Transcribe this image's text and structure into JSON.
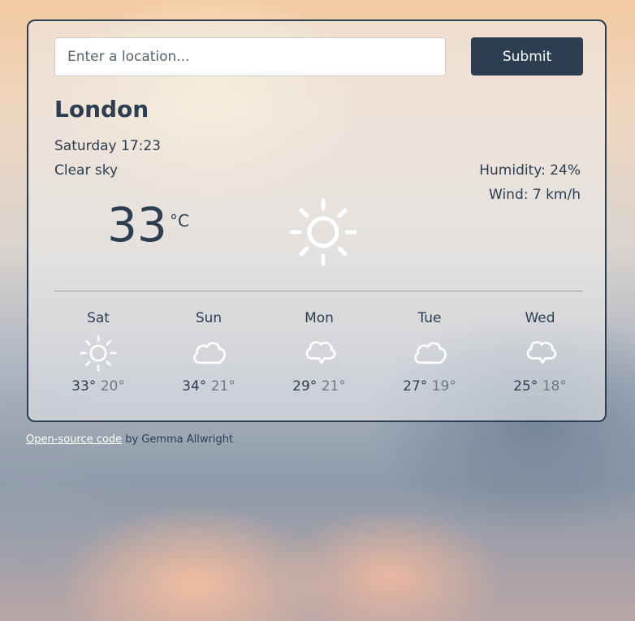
{
  "search": {
    "placeholder": "Enter a location...",
    "value": ""
  },
  "submit_label": "Submit",
  "current": {
    "city": "London",
    "datetime": "Saturday 17:23",
    "description": "Clear sky",
    "humidity": "Humidity: 24%",
    "wind": "Wind: 7 km/h",
    "temperature": "33",
    "unit": "°C",
    "icon": "sun-icon"
  },
  "forecast": [
    {
      "day": "Sat",
      "max": "33°",
      "min": "20°",
      "icon": "sun-icon"
    },
    {
      "day": "Sun",
      "max": "34°",
      "min": "21°",
      "icon": "cloud-icon"
    },
    {
      "day": "Mon",
      "max": "29°",
      "min": "21°",
      "icon": "cloud-icon"
    },
    {
      "day": "Tue",
      "max": "27°",
      "min": "19°",
      "icon": "cloud-icon"
    },
    {
      "day": "Wed",
      "max": "25°",
      "min": "18°",
      "icon": "cloud-icon"
    }
  ],
  "footer": {
    "link_text": "Open-source code",
    "suffix": " by Gemma Allwright"
  },
  "colors": {
    "primary": "#2c3e50",
    "min_temp": "#6e7882",
    "icon": "#ffffff"
  }
}
